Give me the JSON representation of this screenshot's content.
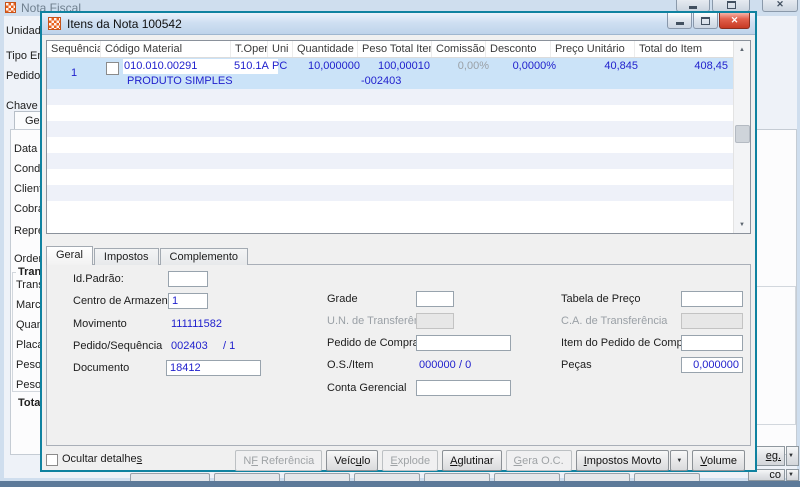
{
  "icons": {
    "close": "✕",
    "scroll_up": "▲",
    "scroll_down": "▼",
    "dropdown": "▼"
  },
  "colors": {
    "dialog_border": "#0f82a0",
    "selected_row": "#cbe3f8",
    "value_text": "#2121cd"
  },
  "parent_window": {
    "title": "Nota Fiscal",
    "labels": {
      "unidade": "Unidade",
      "tipo_emissao": "Tipo Emi",
      "pedido": "Pedido",
      "chave": "Chave N",
      "tab_geral": "Ger",
      "data": "Data",
      "condicao": "Condi",
      "cliente": "Client",
      "cobranca": "Cobra",
      "representante": "Repre",
      "ordem": "Order",
      "transporte_group": "Tran",
      "transportadora": "Trans",
      "marca": "Marca",
      "quantidade": "Quan",
      "placa": "Placa",
      "peso_1": "Peso",
      "peso_2": "Peso",
      "total": "Tota"
    },
    "right_buttons": {
      "top": "eg.",
      "bottom": "co"
    }
  },
  "dialog": {
    "title": "Itens da Nota 100542",
    "table": {
      "columns": [
        "Sequência",
        "Código Material",
        "T.Oper.",
        "Uni",
        "Quantidade",
        "Peso Total Item",
        "Comissão",
        "Desconto",
        "Preço Unitário",
        "Total do Item"
      ],
      "row": {
        "sequencia": "1",
        "codigo_material": "010.010.00291",
        "descricao": "PRODUTO SIMPLES",
        "t_oper": "510.1A",
        "uni": "PC",
        "quantidade": "10,000000",
        "peso_total_item": "100,00010",
        "referencia": "-002403",
        "comissao": "0,00%",
        "desconto": "0,0000%",
        "preco_unitario": "40,845",
        "total_do_item": "408,45"
      }
    },
    "tabs": [
      "Geral",
      "Impostos",
      "Complemento"
    ],
    "form": {
      "id_padrao": {
        "label": "Id.Padrão:",
        "value": ""
      },
      "centro_armazenagem": {
        "label": "Centro de Armazenagem",
        "value": "1"
      },
      "movimento": {
        "label": "Movimento",
        "value": "111111582"
      },
      "pedido_sequencia": {
        "label": "Pedido/Sequência",
        "value": "002403",
        "value2": "/ 1"
      },
      "documento": {
        "label": "Documento",
        "value": "18412"
      },
      "grade": {
        "label": "Grade",
        "value": ""
      },
      "un_transferencia": {
        "label": "U.N. de Transferência",
        "value": ""
      },
      "pedido_compra": {
        "label": "Pedido de Compra",
        "value": ""
      },
      "os_item": {
        "label": "O.S./Item",
        "value": "000000",
        "value2": "/ 0"
      },
      "conta_gerencial": {
        "label": "Conta Gerencial",
        "value": ""
      },
      "tabela_preco": {
        "label": "Tabela de Preço",
        "value": ""
      },
      "ca_transferencia": {
        "label": "C.A. de Transferência",
        "value": ""
      },
      "item_pedido_compra": {
        "label": "Item do Pedido de Compra",
        "value": ""
      },
      "pecas": {
        "label": "Peças",
        "value": "0,000000"
      }
    },
    "footer": {
      "hide_details": {
        "pre": "Ocultar detalhe",
        "mn": "s"
      },
      "buttons": {
        "nf_referencia": {
          "pre": "N",
          "mn": "F",
          "post": " Referência"
        },
        "veiculo": {
          "pre": "Veíc",
          "mn": "u",
          "post": "lo"
        },
        "explode": {
          "pre": "",
          "mn": "E",
          "post": "xplode"
        },
        "aglutinar": {
          "pre": "",
          "mn": "A",
          "post": "glutinar"
        },
        "gera_oc": {
          "pre": "",
          "mn": "G",
          "post": "era O.C."
        },
        "impostos_movto": {
          "pre": "",
          "mn": "I",
          "post": "mpostos Movto"
        },
        "volume": {
          "pre": "",
          "mn": "V",
          "post": "olume"
        }
      }
    }
  }
}
